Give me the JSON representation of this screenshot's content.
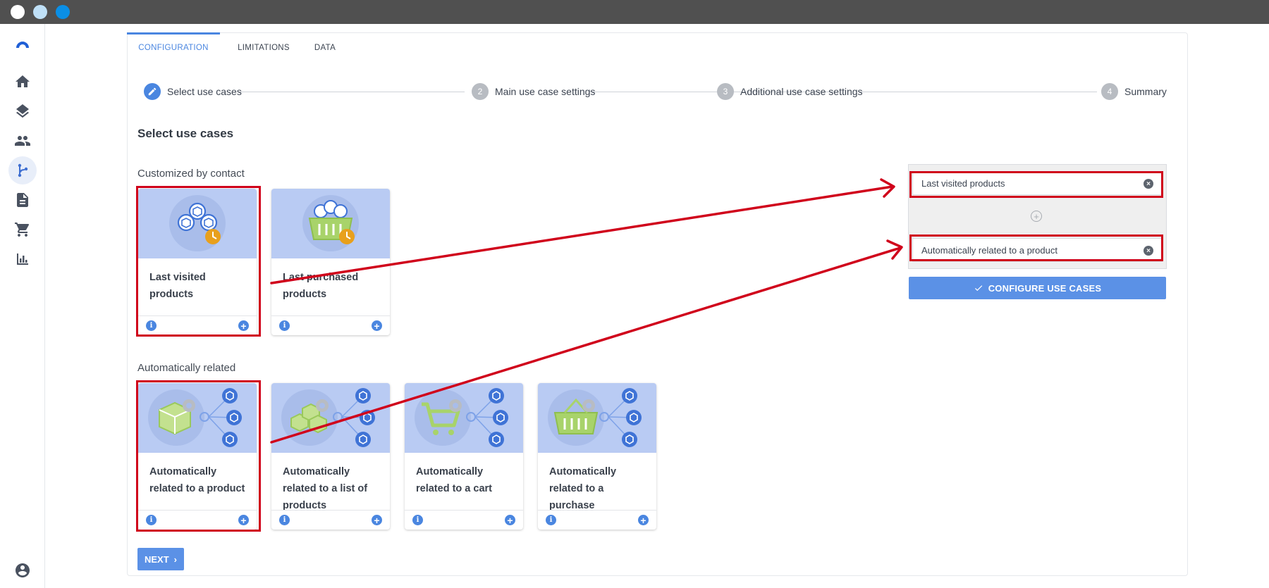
{
  "window": {
    "controls": [
      {
        "name": "close",
        "color": "#ffffff"
      },
      {
        "name": "minimize",
        "color": "#bfe0f7"
      },
      {
        "name": "maximize",
        "color": "#0a8fe6"
      }
    ]
  },
  "sidebar": {
    "items": [
      {
        "icon": "logo-icon"
      },
      {
        "icon": "home-icon"
      },
      {
        "icon": "layers-icon"
      },
      {
        "icon": "people-icon"
      },
      {
        "icon": "flow-icon",
        "active": true
      },
      {
        "icon": "document-icon"
      },
      {
        "icon": "cart-icon"
      },
      {
        "icon": "bar-chart-icon"
      },
      {
        "icon": "account-icon"
      }
    ]
  },
  "tabs": [
    {
      "label": "CONFIGURATION",
      "active": true
    },
    {
      "label": "LIMITATIONS"
    },
    {
      "label": "DATA"
    }
  ],
  "stepper": {
    "steps": [
      {
        "number": "",
        "label": "Select use cases",
        "active": true
      },
      {
        "number": "2",
        "label": "Main use case settings"
      },
      {
        "number": "3",
        "label": "Additional use case settings"
      },
      {
        "number": "4",
        "label": "Summary"
      }
    ]
  },
  "main": {
    "title": "Select use cases",
    "groups": [
      {
        "title": "Customized by contact",
        "cards": [
          {
            "title": "Last visited products",
            "highlighted": true
          },
          {
            "title": "Last purchased products"
          }
        ]
      },
      {
        "title": "Automatically related",
        "cards": [
          {
            "title": "Automatically related to a product",
            "highlighted": true
          },
          {
            "title": "Automatically related to a list of products"
          },
          {
            "title": "Automatically related to a cart"
          },
          {
            "title": "Automatically related to a purchase"
          }
        ]
      }
    ],
    "info_glyph": "i",
    "add_glyph": "+"
  },
  "selected": {
    "items": [
      {
        "label": "Last visited products"
      },
      {
        "label": "Automatically related to a product"
      }
    ],
    "remove_glyph": "×",
    "add_slot_glyph": "+",
    "configure_label": "CONFIGURE USE CASES"
  },
  "footer": {
    "next_label": "NEXT"
  },
  "colors": {
    "accent": "#4a86e0",
    "button": "#5b91e6",
    "highlight": "#d0021b",
    "card_image_bg": "#b9cbf3"
  }
}
